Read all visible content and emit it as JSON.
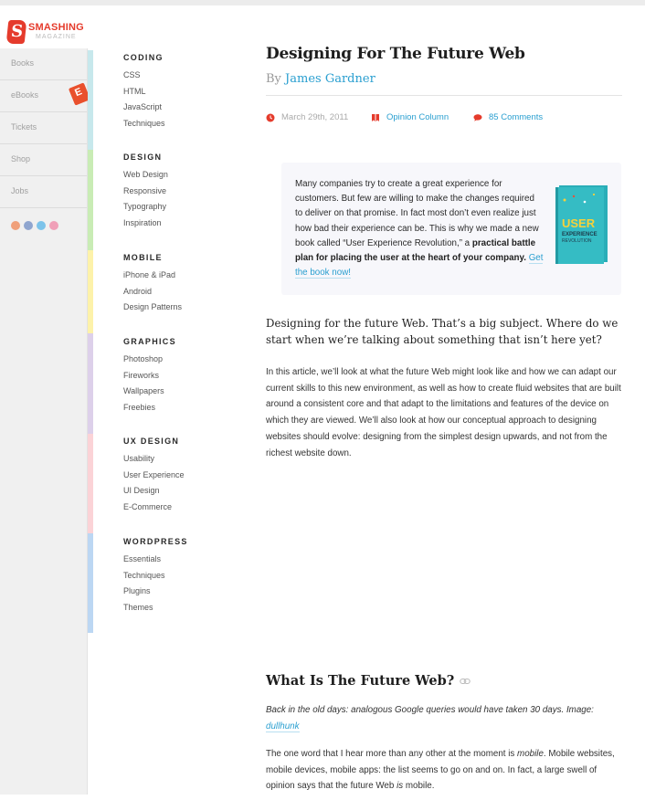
{
  "brand": {
    "name": "SMASHING",
    "sub": "MAGAZINE"
  },
  "nav": [
    {
      "label": "Books"
    },
    {
      "label": "eBooks"
    },
    {
      "label": "Tickets"
    },
    {
      "label": "Shop"
    },
    {
      "label": "Jobs"
    }
  ],
  "social": [
    "rss-icon",
    "facebook-icon",
    "twitter-icon",
    "dribbble-icon"
  ],
  "colors": {
    "accent": "#e53b2c",
    "link": "#2a9fd0",
    "strip": [
      "#c7e8ec",
      "#c9ecb5",
      "#fdf2aa",
      "#ddd0ea",
      "#fbd3d7",
      "#bcd7f3"
    ]
  },
  "categories": [
    {
      "title": "CODING",
      "links": [
        "CSS",
        "HTML",
        "JavaScript",
        "Techniques"
      ]
    },
    {
      "title": "DESIGN",
      "links": [
        "Web Design",
        "Responsive",
        "Typography",
        "Inspiration"
      ]
    },
    {
      "title": "MOBILE",
      "links": [
        "iPhone & iPad",
        "Android",
        "Design Patterns"
      ]
    },
    {
      "title": "GRAPHICS",
      "links": [
        "Photoshop",
        "Fireworks",
        "Wallpapers",
        "Freebies"
      ]
    },
    {
      "title": "UX DESIGN",
      "links": [
        "Usability",
        "User Experience",
        "UI Design",
        "E-Commerce"
      ]
    },
    {
      "title": "WORDPRESS",
      "links": [
        "Essentials",
        "Techniques",
        "Plugins",
        "Themes"
      ]
    }
  ],
  "article": {
    "title": "Designing For The Future Web",
    "by": "By",
    "author": "James Gardner",
    "date": "March 29th, 2011",
    "column": "Opinion Column",
    "comments": "85 Comments",
    "promo": {
      "text": "Many companies try to create a great experience for customers. But few are willing to make the changes required to deliver on that promise. In fact most don’t even realize just how bad their experience can be. This is why we made a new book called “User Experience Revolution,” a",
      "bold": "practical battle plan for placing the user at the heart of your company.",
      "cta": "Get the book now!",
      "book_title_1": "USER",
      "book_title_2": "EXPERIENCE",
      "book_title_3": "REVOLUTION"
    },
    "lead": "Designing for the future Web. That’s a big subject. Where do we start when we’re talking about something that isn’t here yet?",
    "p1": "In this article, we’ll look at what the future Web might look like and how we can adapt our current skills to this new environment, as well as how to create fluid websites that are built around a consistent core and that adapt to the limitations and features of the device on which they are viewed. We’ll also look at how our conceptual approach to designing websites should evolve: designing from the simplest design upwards, and not from the richest website down.",
    "h2": "What Is The Future Web?",
    "caption": "Back in the old days: analogous Google queries would have taken 30 days. Image:",
    "caption_link": "dullhunk",
    "p2_a": "The one word that I hear more than any other at the moment is",
    "p2_em": "mobile",
    "p2_b": ". Mobile websites, mobile devices, mobile apps: the list seems to go on and on. In fact, a large swell of opinion says that the future Web",
    "p2_em2": "is",
    "p2_c": "mobile."
  }
}
